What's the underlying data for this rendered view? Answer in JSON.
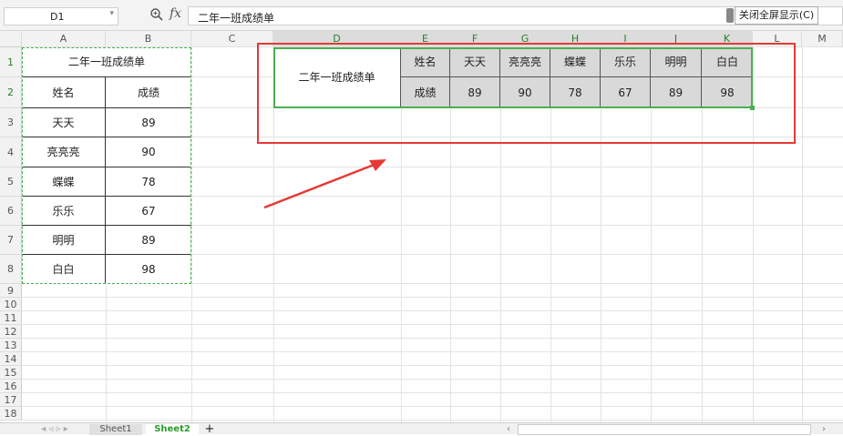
{
  "formula_bar": {
    "name_box": "D1",
    "fx_label": "fx",
    "formula": "二年一班成绩单",
    "close_fullscreen_label": "关闭全屏显示(C)"
  },
  "columns": [
    "A",
    "B",
    "C",
    "D",
    "E",
    "F",
    "G",
    "H",
    "I",
    "J",
    "K",
    "L",
    "M"
  ],
  "rows": [
    "1",
    "2",
    "3",
    "4",
    "5",
    "6",
    "7",
    "8",
    "9",
    "10",
    "11",
    "12",
    "13",
    "14",
    "15",
    "16",
    "17",
    "18"
  ],
  "source_table": {
    "title": "二年一班成绩单",
    "headers": [
      "姓名",
      "成绩"
    ],
    "rows": [
      [
        "天天",
        "89"
      ],
      [
        "亮亮亮",
        "90"
      ],
      [
        "蝶蝶",
        "78"
      ],
      [
        "乐乐",
        "67"
      ],
      [
        "明明",
        "89"
      ],
      [
        "白白",
        "98"
      ]
    ]
  },
  "transposed_table": {
    "title": "二年一班成绩单",
    "row_labels": [
      "姓名",
      "成绩"
    ],
    "names": [
      "天天",
      "亮亮亮",
      "蝶蝶",
      "乐乐",
      "明明",
      "白白"
    ],
    "scores": [
      "89",
      "90",
      "78",
      "67",
      "89",
      "98"
    ]
  },
  "sheet_tabs": [
    "Sheet1",
    "Sheet2"
  ],
  "active_sheet": "Sheet2",
  "add_sheet_label": "+",
  "colors": {
    "selection_green": "#4caf50",
    "annotation_red": "#e53935",
    "header_gray": "#d9d9d9"
  }
}
